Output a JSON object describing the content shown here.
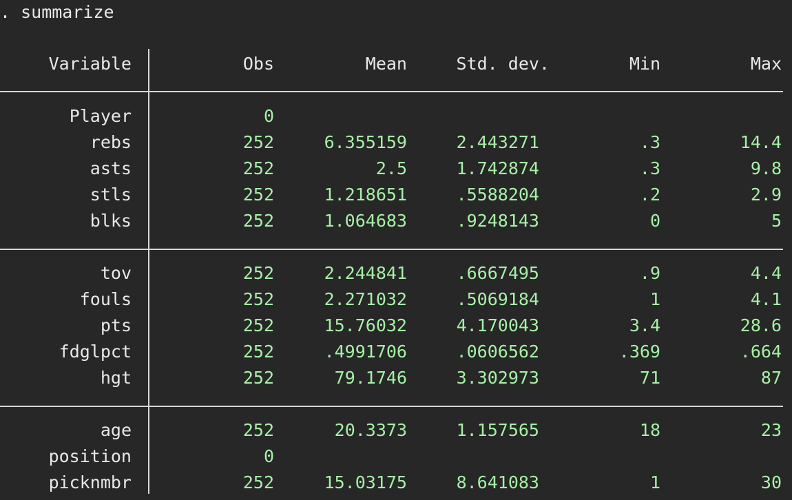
{
  "command": ". summarize",
  "headers": {
    "variable": "Variable",
    "obs": "Obs",
    "mean": "Mean",
    "sd": "Std. dev.",
    "min": "Min",
    "max": "Max"
  },
  "groups": [
    [
      {
        "name": "Player",
        "obs": "0",
        "mean": "",
        "sd": "",
        "min": "",
        "max": ""
      },
      {
        "name": "rebs",
        "obs": "252",
        "mean": "6.355159",
        "sd": "2.443271",
        "min": ".3",
        "max": "14.4"
      },
      {
        "name": "asts",
        "obs": "252",
        "mean": "2.5",
        "sd": "1.742874",
        "min": ".3",
        "max": "9.8"
      },
      {
        "name": "stls",
        "obs": "252",
        "mean": "1.218651",
        "sd": ".5588204",
        "min": ".2",
        "max": "2.9"
      },
      {
        "name": "blks",
        "obs": "252",
        "mean": "1.064683",
        "sd": ".9248143",
        "min": "0",
        "max": "5"
      }
    ],
    [
      {
        "name": "tov",
        "obs": "252",
        "mean": "2.244841",
        "sd": ".6667495",
        "min": ".9",
        "max": "4.4"
      },
      {
        "name": "fouls",
        "obs": "252",
        "mean": "2.271032",
        "sd": ".5069184",
        "min": "1",
        "max": "4.1"
      },
      {
        "name": "pts",
        "obs": "252",
        "mean": "15.76032",
        "sd": "4.170043",
        "min": "3.4",
        "max": "28.6"
      },
      {
        "name": "fdglpct",
        "obs": "252",
        "mean": ".4991706",
        "sd": ".0606562",
        "min": ".369",
        "max": ".664"
      },
      {
        "name": "hgt",
        "obs": "252",
        "mean": "79.1746",
        "sd": "3.302973",
        "min": "71",
        "max": "87"
      }
    ],
    [
      {
        "name": "age",
        "obs": "252",
        "mean": "20.3373",
        "sd": "1.157565",
        "min": "18",
        "max": "23"
      },
      {
        "name": "position",
        "obs": "0",
        "mean": "",
        "sd": "",
        "min": "",
        "max": ""
      },
      {
        "name": "picknmbr",
        "obs": "252",
        "mean": "15.03175",
        "sd": "8.641083",
        "min": "1",
        "max": "30"
      }
    ]
  ]
}
